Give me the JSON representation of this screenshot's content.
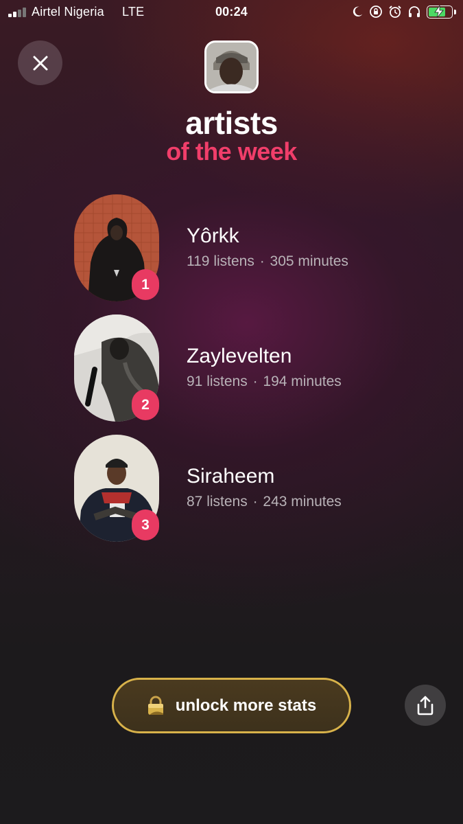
{
  "status_bar": {
    "carrier": "Airtel Nigeria",
    "network": "LTE",
    "time": "00:24",
    "icons": [
      "moon-icon",
      "orientation-lock-icon",
      "alarm-icon",
      "headphones-icon",
      "battery-charging-icon"
    ]
  },
  "header": {
    "close_icon": "close-icon",
    "title": "artists",
    "subtitle": "of the week"
  },
  "artists": [
    {
      "rank": "1",
      "name": "Yôrkk",
      "listens": "119 listens",
      "minutes": "305 minutes"
    },
    {
      "rank": "2",
      "name": "Zaylevelten",
      "listens": "91 listens",
      "minutes": "194 minutes"
    },
    {
      "rank": "3",
      "name": "Siraheem",
      "listens": "87 listens",
      "minutes": "243 minutes"
    }
  ],
  "separator": "·",
  "footer": {
    "unlock_label": "unlock more stats",
    "unlock_icon": "lock-icon",
    "share_icon": "share-icon"
  },
  "colors": {
    "accent": "#f03e6a",
    "badge": "#e83a62",
    "unlock_border": "#d8b24a"
  }
}
